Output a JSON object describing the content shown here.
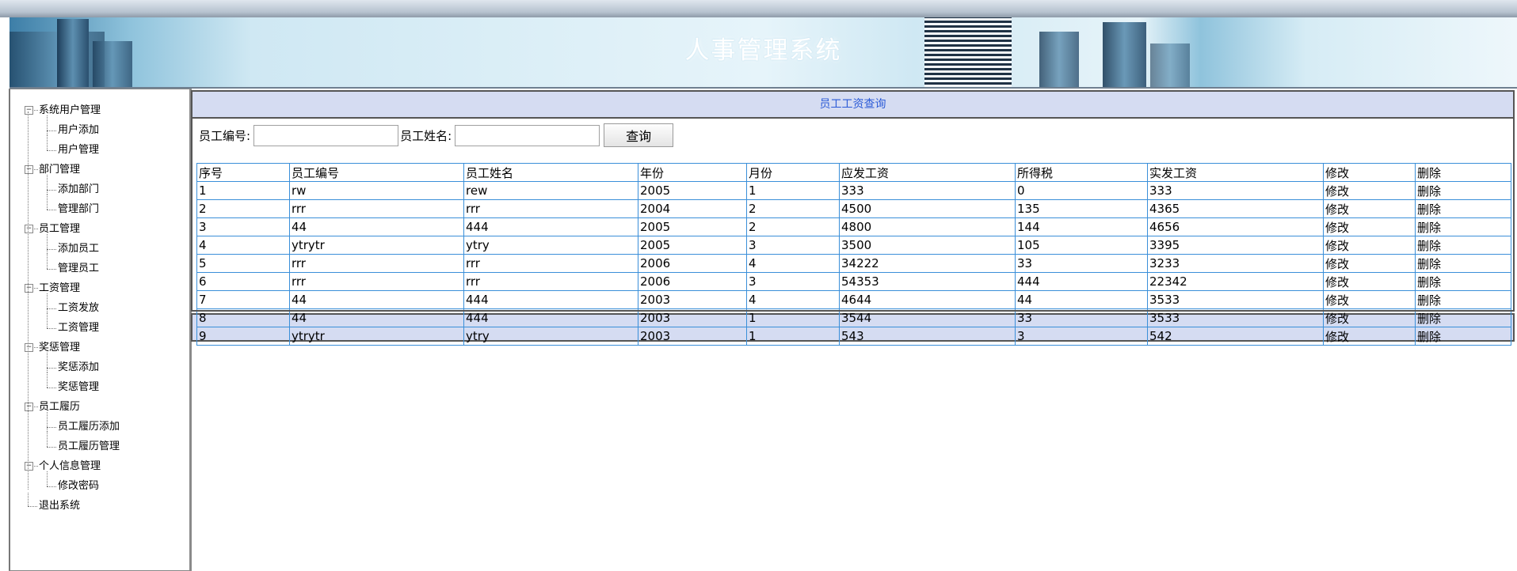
{
  "app": {
    "title": "人事管理系统"
  },
  "sidebar": {
    "groups": [
      {
        "label": "系统用户管理",
        "items": [
          "用户添加",
          "用户管理"
        ]
      },
      {
        "label": "部门管理",
        "items": [
          "添加部门",
          "管理部门"
        ]
      },
      {
        "label": "员工管理",
        "items": [
          "添加员工",
          "管理员工"
        ]
      },
      {
        "label": "工资管理",
        "items": [
          "工资发放",
          "工资管理"
        ]
      },
      {
        "label": "奖惩管理",
        "items": [
          "奖惩添加",
          "奖惩管理"
        ]
      },
      {
        "label": "员工履历",
        "items": [
          "员工履历添加",
          "员工履历管理"
        ]
      },
      {
        "label": "个人信息管理",
        "items": [
          "修改密码"
        ]
      }
    ],
    "exit_label": "退出系统",
    "toggle_symbol": "−"
  },
  "panel": {
    "title": "员工工资查询"
  },
  "search": {
    "id_label": "员工编号:",
    "id_value": "",
    "name_label": "员工姓名:",
    "name_value": "",
    "button_label": "查询"
  },
  "table": {
    "headers": [
      "序号",
      "员工编号",
      "员工姓名",
      "年份",
      "月份",
      "应发工资",
      "所得税",
      "实发工资",
      "修改",
      "删除"
    ],
    "rows": [
      [
        "1",
        "rw",
        "rew",
        "2005",
        "1",
        "333",
        "0",
        "333",
        "修改",
        "删除"
      ],
      [
        "2",
        "rrr",
        "rrr",
        "2004",
        "2",
        "4500",
        "135",
        "4365",
        "修改",
        "删除"
      ],
      [
        "3",
        "44",
        "444",
        "2005",
        "2",
        "4800",
        "144",
        "4656",
        "修改",
        "删除"
      ],
      [
        "4",
        "ytrytr",
        "ytry",
        "2005",
        "3",
        "3500",
        "105",
        "3395",
        "修改",
        "删除"
      ],
      [
        "5",
        "rrr",
        "rrr",
        "2006",
        "4",
        "34222",
        "33",
        "3233",
        "修改",
        "删除"
      ],
      [
        "6",
        "rrr",
        "rrr",
        "2006",
        "3",
        "54353",
        "444",
        "22342",
        "修改",
        "删除"
      ],
      [
        "7",
        "44",
        "444",
        "2003",
        "4",
        "4644",
        "44",
        "3533",
        "修改",
        "删除"
      ],
      [
        "8",
        "44",
        "444",
        "2003",
        "1",
        "3544",
        "33",
        "3533",
        "修改",
        "删除"
      ],
      [
        "9",
        "ytrytr",
        "ytry",
        "2003",
        "1",
        "543",
        "3",
        "542",
        "修改",
        "删除"
      ]
    ]
  },
  "colors": {
    "accent": "#2a5ad7",
    "header_bg": "#d5dcf2",
    "grid_border": "#3a8fd9"
  }
}
